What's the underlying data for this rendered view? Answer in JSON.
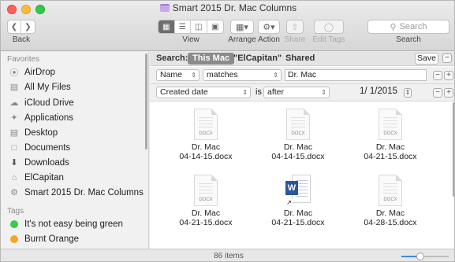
{
  "window": {
    "title": "Smart 2015 Dr. Mac Columns"
  },
  "toolbar": {
    "back_label": "Back",
    "view_label": "View",
    "arrange_label": "Arrange",
    "action_label": "Action",
    "share_label": "Share",
    "edit_tags_label": "Edit Tags",
    "search_placeholder": "Search",
    "search_label": "Search"
  },
  "sidebar": {
    "favorites_heading": "Favorites",
    "favorites": [
      {
        "label": "AirDrop",
        "icon": "airdrop-icon"
      },
      {
        "label": "All My Files",
        "icon": "all-files-icon"
      },
      {
        "label": "iCloud Drive",
        "icon": "cloud-icon"
      },
      {
        "label": "Applications",
        "icon": "applications-icon"
      },
      {
        "label": "Desktop",
        "icon": "desktop-icon"
      },
      {
        "label": "Documents",
        "icon": "documents-icon"
      },
      {
        "label": "Downloads",
        "icon": "downloads-icon"
      },
      {
        "label": "ElCapitan",
        "icon": "home-icon"
      },
      {
        "label": "Smart 2015 Dr. Mac Columns",
        "icon": "smart-folder-icon"
      }
    ],
    "tags_heading": "Tags",
    "tags": [
      {
        "label": "It's not easy being green",
        "color": "#3cc84a"
      },
      {
        "label": "Burnt Orange",
        "color": "#f5a623"
      }
    ]
  },
  "search_bar": {
    "label": "Search:",
    "scope_this_mac": "This Mac",
    "scope_elcapitan": "\"ElCapitan\"",
    "scope_shared": "Shared",
    "save_label": "Save"
  },
  "criteria": [
    {
      "attribute": "Name",
      "operator": "matches",
      "value": "Dr. Mac"
    },
    {
      "attribute": "Created date",
      "is_label": "is",
      "operator": "after",
      "value": "1/ 1/2015"
    }
  ],
  "files": [
    {
      "line1": "Dr. Mac",
      "line2": "04-14-15.docx",
      "kind": "DOCX"
    },
    {
      "line1": "Dr. Mac",
      "line2": "04-14-15.docx",
      "kind": "DOCX"
    },
    {
      "line1": "Dr. Mac",
      "line2": "04-21-15.docx",
      "kind": "DOCX"
    },
    {
      "line1": "Dr. Mac",
      "line2": "04-21-15.docx",
      "kind": "DOCX"
    },
    {
      "line1": "Dr. Mac",
      "line2": "04-21-15.docx",
      "kind": "WORD"
    },
    {
      "line1": "Dr. Mac",
      "line2": "04-28-15.docx",
      "kind": "DOCX"
    }
  ],
  "status": {
    "item_count": "86 items",
    "icon_size_level": 0.4
  },
  "colors": {
    "selected_scope": "#8b8b8b",
    "word_blue": "#2b5797"
  }
}
